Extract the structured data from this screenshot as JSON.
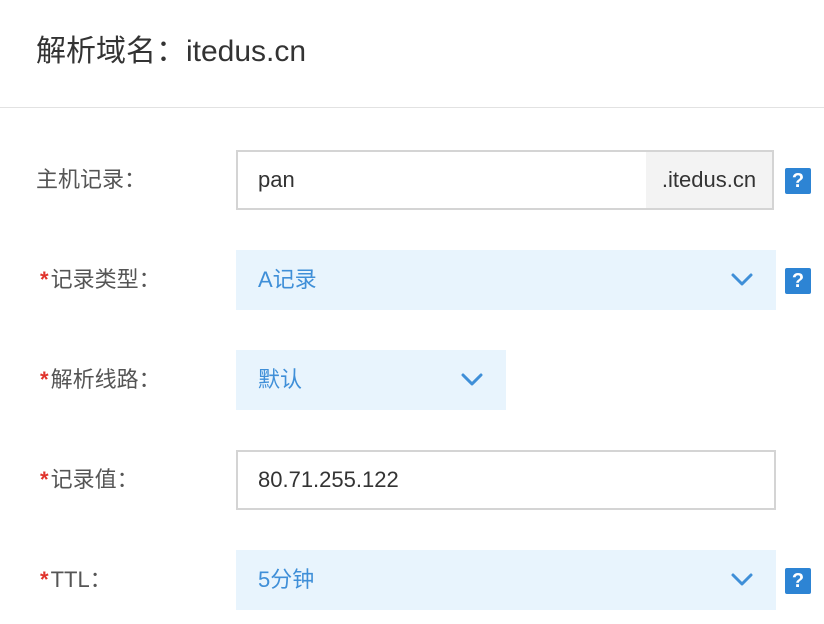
{
  "header": {
    "title": "解析域名：itedus.cn"
  },
  "form": {
    "host_record": {
      "label": "主机记录：",
      "value": "pan",
      "suffix": ".itedus.cn",
      "help": "?"
    },
    "record_type": {
      "required_mark": "*",
      "label": "记录类型：",
      "value": "A记录",
      "help": "?"
    },
    "line": {
      "required_mark": "*",
      "label": "解析线路：",
      "value": "默认"
    },
    "record_value": {
      "required_mark": "*",
      "label": "记录值：",
      "value": "80.71.255.122"
    },
    "ttl": {
      "required_mark": "*",
      "label": "TTL：",
      "value": "5分钟",
      "help": "?"
    }
  },
  "icons": {
    "dropdown": "chevron-down-icon",
    "help": "question-mark-icon"
  },
  "colors": {
    "accent": "#2d84d4",
    "select_bg": "#e8f4fd",
    "select_text": "#3f8fd8",
    "required": "#e0332c"
  }
}
